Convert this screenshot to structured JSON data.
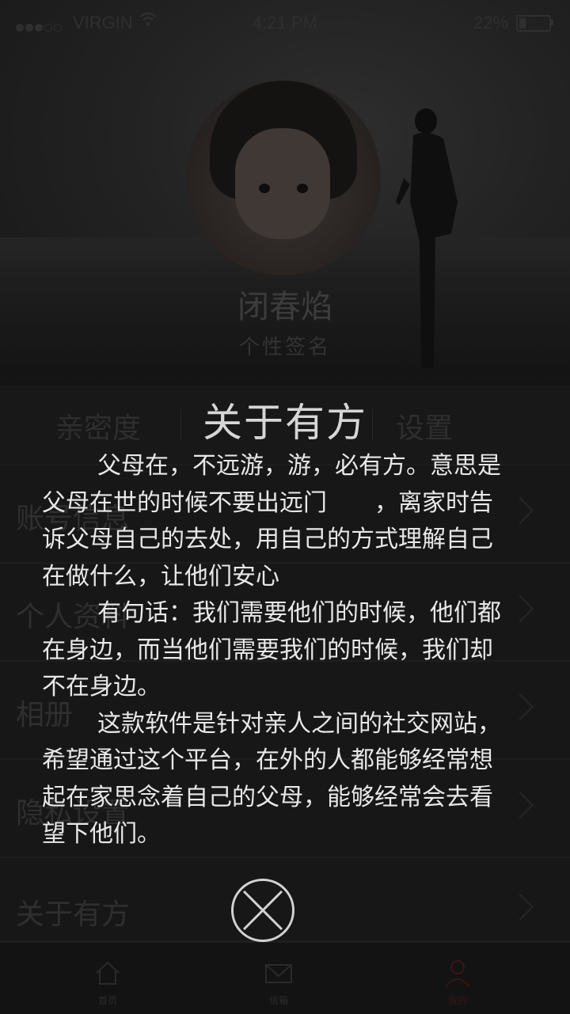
{
  "status_bar": {
    "carrier": "VIRGIN",
    "time": "4:21 PM",
    "battery": "22%"
  },
  "profile": {
    "name": "闭春焰",
    "signature": "个性签名"
  },
  "tabs": [
    "亲密度",
    "",
    "设置"
  ],
  "menu": [
    {
      "label": "账号信息"
    },
    {
      "label": "个人资料"
    },
    {
      "label": "相册"
    },
    {
      "label": "隐私设置"
    },
    {
      "label": "关于有方"
    }
  ],
  "about": {
    "title": "关于有方",
    "paragraphs": [
      "父母在，不远游，游，必有方。意思是父母在世的时候不要出远门　　，离家时告诉父母自己的去处，用自己的方式理解自己在做什么，让他们安心",
      "有句话：我们需要他们的时候，他们都在身边，而当他们需要我们的时候，我们却不在身边。",
      "这款软件是针对亲人之间的社交网站，希望通过这个平台，在外的人都能够经常想起在家思念着自己的父母，能够经常会去看望下他们。"
    ],
    "close_icon": "close-circle-icon"
  },
  "bottom_nav": [
    {
      "label": "首页",
      "icon": "home-icon"
    },
    {
      "label": "信箱",
      "icon": "mail-icon"
    },
    {
      "label": "我的",
      "icon": "user-icon",
      "active_color": "#8a1f1f"
    }
  ]
}
